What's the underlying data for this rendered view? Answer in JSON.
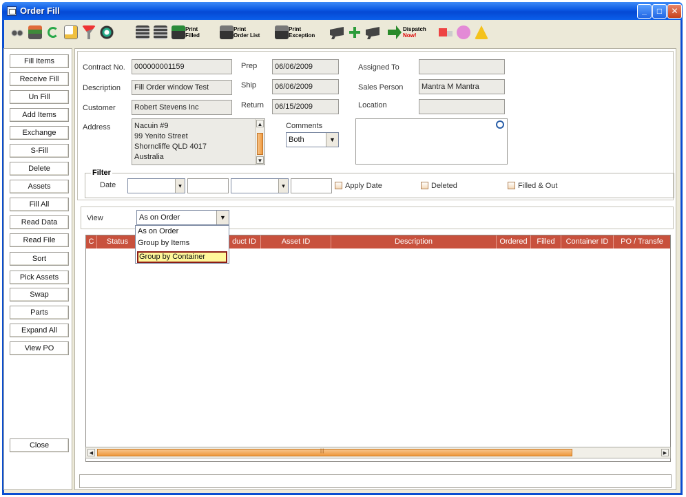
{
  "window": {
    "title": "Order Fill",
    "minimize": "_",
    "maximize": "□",
    "close": "✕"
  },
  "toolbar": {
    "print_filled": [
      "Print",
      "Filled"
    ],
    "print_order_list": [
      "Print",
      "Order List"
    ],
    "print_exception": [
      "Print",
      "Exception"
    ],
    "dispatch_now": [
      "Dispatch",
      "Now!"
    ]
  },
  "sidebar": {
    "buttons": [
      "Fill Items",
      "Receive Fill",
      "Un Fill",
      "Add Items",
      "Exchange",
      "S-Fill",
      "Delete",
      "Assets",
      "Fill All",
      "Read Data",
      "Read File",
      "Sort",
      "Pick Assets",
      "Swap",
      "Parts",
      "Expand All",
      "View PO"
    ],
    "close": "Close"
  },
  "form": {
    "contract_no_label": "Contract No.",
    "contract_no": "000000001159",
    "description_label": "Description",
    "description": "Fill Order window Test",
    "customer_label": "Customer",
    "customer": "Robert Stevens Inc",
    "address_label": "Address",
    "address_lines": [
      "Nacuin #9",
      "99 Yenito Street",
      "Shorncliffe QLD 4017",
      "Australia"
    ],
    "prep_label": "Prep",
    "prep": "06/06/2009",
    "ship_label": "Ship",
    "ship": "06/06/2009",
    "return_label": "Return",
    "return": "06/15/2009",
    "comments_label": "Comments",
    "comments_value": "Both",
    "assigned_to_label": "Assigned To",
    "assigned_to": "",
    "sales_person_label": "Sales Person",
    "sales_person": "Mantra M Mantra",
    "location_label": "Location",
    "location": ""
  },
  "filter": {
    "legend": "Filter",
    "date_label": "Date",
    "apply_date": "Apply Date",
    "deleted": "Deleted",
    "filled_out": "Filled & Out"
  },
  "view": {
    "label": "View",
    "selected": "As on Order",
    "options": [
      "As on Order",
      "Group by Items",
      "Group by Container"
    ],
    "highlighted": "Group by Container"
  },
  "grid": {
    "columns": [
      "C",
      "Status",
      "",
      "duct ID",
      "Asset ID",
      "Description",
      "Ordered",
      "Filled",
      "Container ID",
      "PO / Transfe"
    ]
  },
  "colors": {
    "title_blue": "#0a57e2",
    "header_red": "#c8513d",
    "highlight_yellow": "#fff79b",
    "scroll_orange": "#ef9a3f"
  }
}
